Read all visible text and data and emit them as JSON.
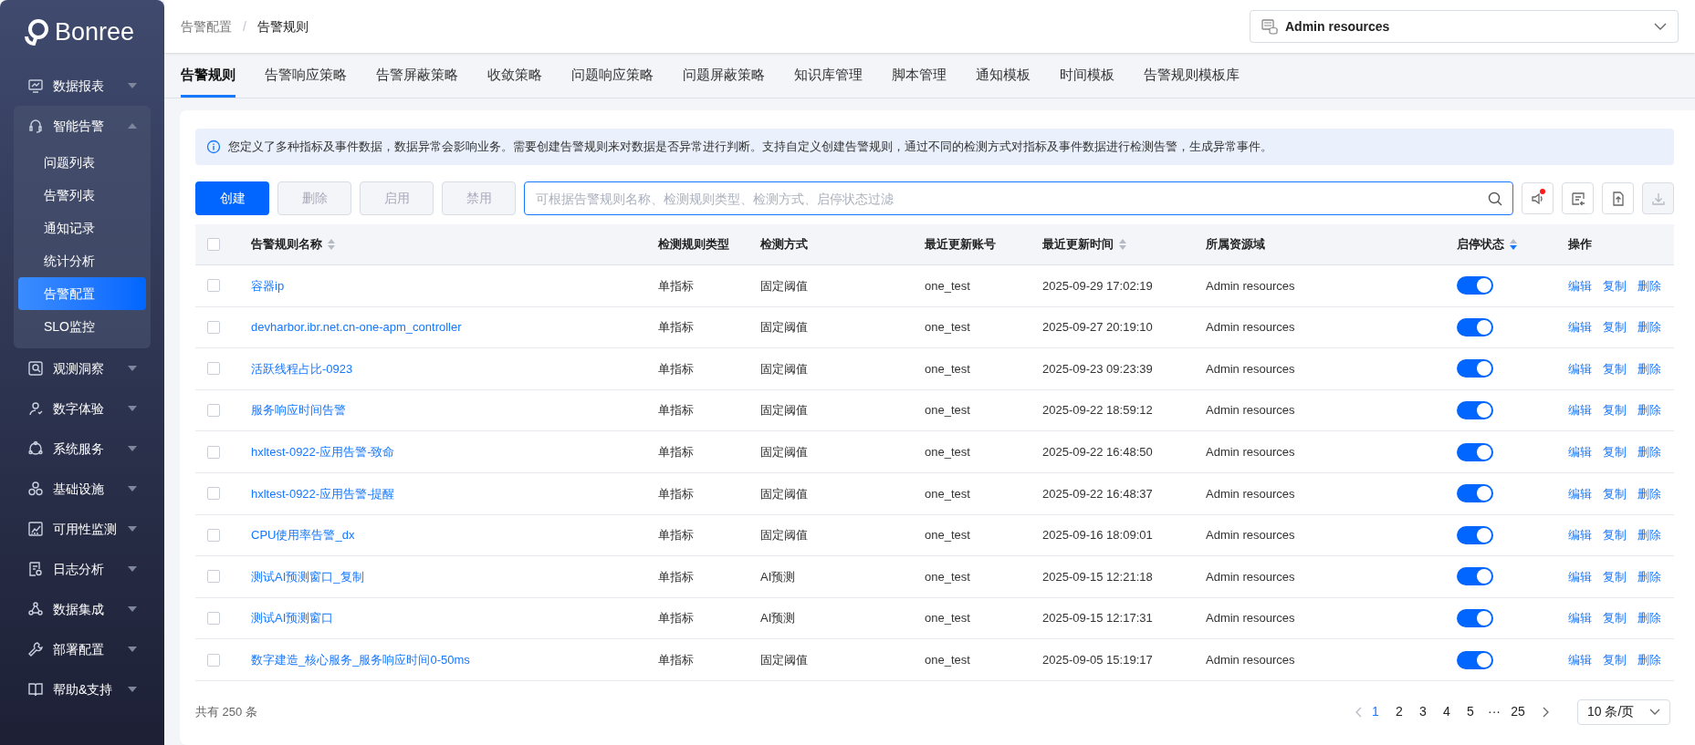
{
  "sidebar": {
    "logo": "Bonree",
    "items": [
      {
        "label": "数据报表",
        "expanded": false
      },
      {
        "label": "智能告警",
        "expanded": true,
        "children": [
          {
            "label": "问题列表",
            "selected": false
          },
          {
            "label": "告警列表",
            "selected": false
          },
          {
            "label": "通知记录",
            "selected": false
          },
          {
            "label": "统计分析",
            "selected": false
          },
          {
            "label": "告警配置",
            "selected": true
          },
          {
            "label": "SLO监控",
            "selected": false
          }
        ]
      },
      {
        "label": "观测洞察",
        "expanded": false
      },
      {
        "label": "数字体验",
        "expanded": false
      },
      {
        "label": "系统服务",
        "expanded": false
      },
      {
        "label": "基础设施",
        "expanded": false
      },
      {
        "label": "可用性监测",
        "expanded": false
      },
      {
        "label": "日志分析",
        "expanded": false
      },
      {
        "label": "数据集成",
        "expanded": false
      },
      {
        "label": "部署配置",
        "expanded": false
      },
      {
        "label": "帮助&支持",
        "expanded": false
      }
    ]
  },
  "breadcrumb": {
    "items": [
      "告警配置",
      "告警规则"
    ],
    "separator": "/"
  },
  "resource_select": {
    "value": "Admin resources"
  },
  "tabs": [
    {
      "label": "告警规则",
      "selected": true
    },
    {
      "label": "告警响应策略",
      "selected": false
    },
    {
      "label": "告警屏蔽策略",
      "selected": false
    },
    {
      "label": "收敛策略",
      "selected": false
    },
    {
      "label": "问题响应策略",
      "selected": false
    },
    {
      "label": "问题屏蔽策略",
      "selected": false
    },
    {
      "label": "知识库管理",
      "selected": false
    },
    {
      "label": "脚本管理",
      "selected": false
    },
    {
      "label": "通知模板",
      "selected": false
    },
    {
      "label": "时间模板",
      "selected": false
    },
    {
      "label": "告警规则模板库",
      "selected": false
    }
  ],
  "info": "您定义了多种指标及事件数据，数据异常会影响业务。需要创建告警规则来对数据是否异常进行判断。支持自定义创建告警规则，通过不同的检测方式对指标及事件数据进行检测告警，生成异常事件。",
  "buttons": [
    {
      "label": "创建",
      "kind": "primary",
      "disabled": false
    },
    {
      "label": "删除",
      "kind": "default",
      "disabled": true
    },
    {
      "label": "启用",
      "kind": "default",
      "disabled": true
    },
    {
      "label": "禁用",
      "kind": "default",
      "disabled": true
    }
  ],
  "search": {
    "placeholder": "可根据告警规则名称、检测规则类型、检测方式、启停状态过滤"
  },
  "tool_buttons": [
    {
      "badge": true,
      "disabled": false
    },
    {
      "badge": false,
      "disabled": false
    },
    {
      "badge": false,
      "disabled": false
    },
    {
      "badge": false,
      "disabled": true
    }
  ],
  "table": {
    "select_all_checked": false,
    "columns": [
      {
        "label": "告警规则名称",
        "sortable": true,
        "sorted_desc": false
      },
      {
        "label": "检测规则类型"
      },
      {
        "label": "检测方式"
      },
      {
        "label": "最近更新账号"
      },
      {
        "label": "最近更新时间",
        "sortable": true,
        "sorted_desc": false
      },
      {
        "label": "所属资源域"
      },
      {
        "label": "启停状态",
        "sortable": true,
        "sorted_desc": true
      },
      {
        "label": "操作"
      }
    ],
    "rows": [
      {
        "checked": false,
        "name": "容器ip",
        "type": "单指标",
        "method": "固定阈值",
        "account": "one_test",
        "time": "2025-09-29 17:02:19",
        "domain": "Admin resources",
        "enabled": true,
        "actions": [
          "编辑",
          "复制",
          "删除"
        ]
      },
      {
        "checked": false,
        "name": "devharbor.ibr.net.cn-one-apm_controller",
        "type": "单指标",
        "method": "固定阈值",
        "account": "one_test",
        "time": "2025-09-27 20:19:10",
        "domain": "Admin resources",
        "enabled": true,
        "actions": [
          "编辑",
          "复制",
          "删除"
        ]
      },
      {
        "checked": false,
        "name": "活跃线程占比-0923",
        "type": "单指标",
        "method": "固定阈值",
        "account": "one_test",
        "time": "2025-09-23 09:23:39",
        "domain": "Admin resources",
        "enabled": true,
        "actions": [
          "编辑",
          "复制",
          "删除"
        ]
      },
      {
        "checked": false,
        "name": "服务响应时间告警",
        "type": "单指标",
        "method": "固定阈值",
        "account": "one_test",
        "time": "2025-09-22 18:59:12",
        "domain": "Admin resources",
        "enabled": true,
        "actions": [
          "编辑",
          "复制",
          "删除"
        ]
      },
      {
        "checked": false,
        "name": "hxltest-0922-应用告警-致命",
        "type": "单指标",
        "method": "固定阈值",
        "account": "one_test",
        "time": "2025-09-22 16:48:50",
        "domain": "Admin resources",
        "enabled": true,
        "actions": [
          "编辑",
          "复制",
          "删除"
        ]
      },
      {
        "checked": false,
        "name": "hxltest-0922-应用告警-提醒",
        "type": "单指标",
        "method": "固定阈值",
        "account": "one_test",
        "time": "2025-09-22 16:48:37",
        "domain": "Admin resources",
        "enabled": true,
        "actions": [
          "编辑",
          "复制",
          "删除"
        ]
      },
      {
        "checked": false,
        "name": "CPU使用率告警_dx",
        "type": "单指标",
        "method": "固定阈值",
        "account": "one_test",
        "time": "2025-09-16 18:09:01",
        "domain": "Admin resources",
        "enabled": true,
        "actions": [
          "编辑",
          "复制",
          "删除"
        ]
      },
      {
        "checked": false,
        "name": "测试AI预测窗口_复制",
        "type": "单指标",
        "method": "AI预测",
        "account": "one_test",
        "time": "2025-09-15 12:21:18",
        "domain": "Admin resources",
        "enabled": true,
        "actions": [
          "编辑",
          "复制",
          "删除"
        ]
      },
      {
        "checked": false,
        "name": "测试AI预测窗口",
        "type": "单指标",
        "method": "AI预测",
        "account": "one_test",
        "time": "2025-09-15 12:17:31",
        "domain": "Admin resources",
        "enabled": true,
        "actions": [
          "编辑",
          "复制",
          "删除"
        ]
      },
      {
        "checked": false,
        "name": "数字建造_核心服务_服务响应时间0-50ms",
        "type": "单指标",
        "method": "固定阈值",
        "account": "one_test",
        "time": "2025-09-05 15:19:17",
        "domain": "Admin resources",
        "enabled": true,
        "actions": [
          "编辑",
          "复制",
          "删除"
        ]
      }
    ]
  },
  "footer": {
    "total": "共有 250 条",
    "pages": [
      {
        "label": "1",
        "selected": true
      },
      {
        "label": "2",
        "selected": false
      },
      {
        "label": "3",
        "selected": false
      },
      {
        "label": "4",
        "selected": false
      },
      {
        "label": "5",
        "selected": false
      },
      {
        "label": "···",
        "selected": false
      },
      {
        "label": "25",
        "selected": false
      }
    ],
    "page_size": "10 条/页"
  }
}
